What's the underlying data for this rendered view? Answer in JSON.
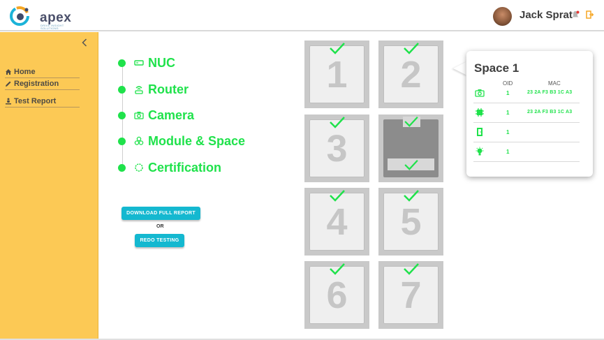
{
  "header": {
    "brand": "apex",
    "brand_sub": "DRIVE INSIGHT SOLUTIONS",
    "user_name": "Jack Sprat"
  },
  "sidebar": {
    "items": [
      {
        "label": "Home",
        "icon": "home-icon"
      },
      {
        "label": "Registration",
        "icon": "pencil-icon"
      },
      {
        "label": "Test Report",
        "icon": "person-stand-icon"
      }
    ]
  },
  "steps": [
    {
      "label": "NUC",
      "icon": "nuc-icon"
    },
    {
      "label": "Router",
      "icon": "router-icon"
    },
    {
      "label": "Camera",
      "icon": "camera-icon"
    },
    {
      "label": "Module & Space",
      "icon": "modules-icon"
    },
    {
      "label": "Certification",
      "icon": "certificate-icon"
    }
  ],
  "actions": {
    "download_label": "DOWNLOAD FULL REPORT",
    "or_label": "OR",
    "redo_label": "REDO TESTING"
  },
  "tiles": [
    "1",
    "2",
    "3",
    "4",
    "5",
    "6",
    "7"
  ],
  "card": {
    "title": "Space 1",
    "col_oid": "OID",
    "col_mac": "MAC",
    "rows": [
      {
        "icon": "camera-icon",
        "oid": "1",
        "mac": "23 2A F3 B3 1C A3"
      },
      {
        "icon": "chip-icon",
        "oid": "1",
        "mac": "23 2A F3 B3 1C A3"
      },
      {
        "icon": "door-icon",
        "oid": "1",
        "mac": ""
      },
      {
        "icon": "light-icon",
        "oid": "1",
        "mac": ""
      }
    ]
  },
  "colors": {
    "accent_green": "#1fe24b",
    "sidebar_yellow": "#fcc955",
    "button_teal": "#14b8d0"
  }
}
